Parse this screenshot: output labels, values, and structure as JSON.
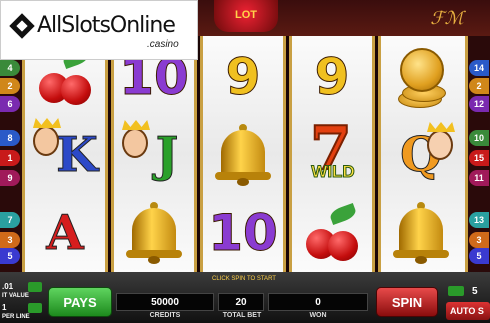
{
  "branding": {
    "logo_main": "AllSlotsOnline",
    "logo_sub": ".casino"
  },
  "header": {
    "game_title": "LOT",
    "corner_decoration": "ℱℳ"
  },
  "reels": [
    [
      "cherries",
      "K",
      "A"
    ],
    [
      "10",
      "J",
      "bell"
    ],
    [
      "9",
      "bell",
      "10"
    ],
    [
      "9",
      "7 WILD",
      "cherries"
    ],
    [
      "coins",
      "Q",
      "bell"
    ]
  ],
  "paylines_left": [
    "4",
    "2",
    "6",
    "8",
    "1",
    "9",
    "7",
    "3",
    "5"
  ],
  "paylines_right": [
    "14",
    "2",
    "12",
    "10",
    "15",
    "11",
    "13",
    "3",
    "5"
  ],
  "controls": {
    "hint": "CLICK SPIN TO START",
    "pays_label": "PAYS",
    "spin_label": "SPIN",
    "credits_value": "50000",
    "credits_label": "CREDITS",
    "total_bet_value": "20",
    "total_bet_label": "TOTAL BET",
    "won_value": "0",
    "won_label": "WON",
    "coin_value": ".01",
    "coin_value_label": "IT VALUE",
    "per_line_value": "1",
    "per_line_label": "PER LINE",
    "lines_value": "5",
    "auto_spin_label": "AUTO S"
  },
  "colors": {
    "pays_button": "#2aa02a",
    "spin_button": "#c41a1a",
    "reel_frame": "#c9a043"
  }
}
